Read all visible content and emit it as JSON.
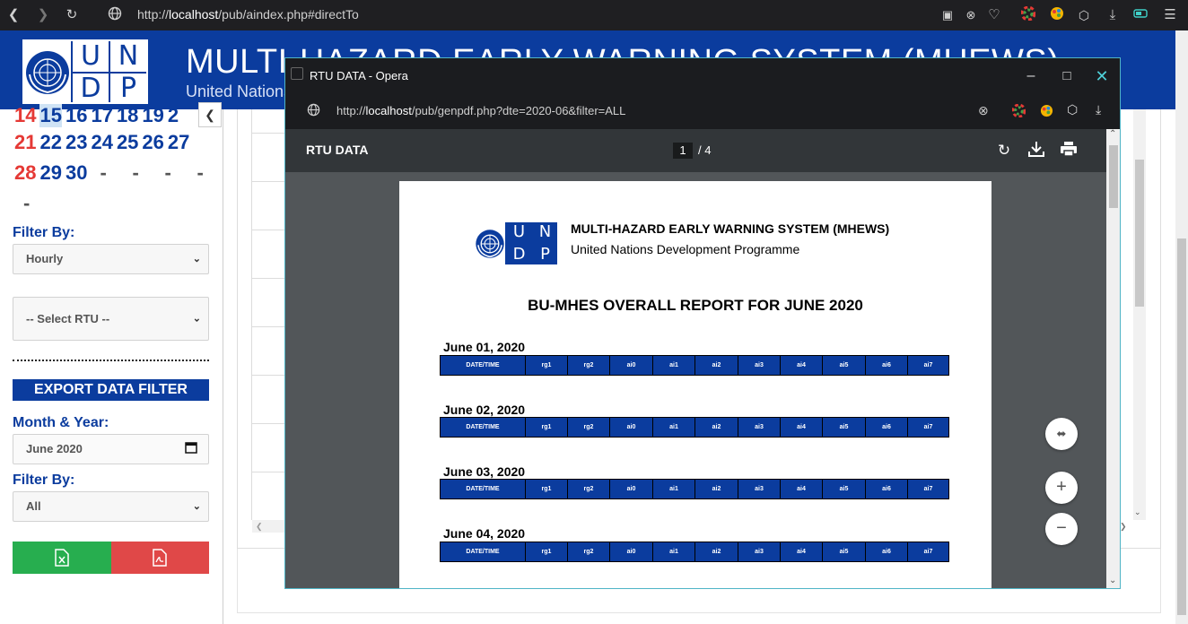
{
  "browser": {
    "url_prefix": "http://",
    "url_host": "localhost",
    "url_path": "/pub/aindex.php#directTo"
  },
  "header": {
    "logo_letters": [
      "U",
      "N",
      "D",
      "P"
    ],
    "title": "MULTI-HAZARD EARLY WARNING SYSTEM (MHEWS)",
    "subtitle": "United Nations Development Programme"
  },
  "calendar": {
    "rows": [
      [
        "14",
        "15",
        "16",
        "17",
        "18",
        "19",
        "2"
      ],
      [
        "21",
        "22",
        "23",
        "24",
        "25",
        "26",
        "27"
      ],
      [
        "28",
        "29",
        "30",
        "-",
        "-",
        "-",
        "-"
      ],
      [
        "-"
      ]
    ]
  },
  "sidebar": {
    "filter_label_1": "Filter By:",
    "filter_select_1": "Hourly",
    "rtu_select": "-- Select RTU --",
    "export_title": "EXPORT DATA FILTER",
    "month_year_label": "Month & Year:",
    "month_year_value": "June 2020",
    "filter_label_2": "Filter By:",
    "filter_select_2": "All"
  },
  "popup": {
    "window_title": "RTU DATA - Opera",
    "url_prefix": "http://",
    "url_host": "localhost",
    "url_path": "/pub/genpdf.php?dte=2020-06&filter=ALL",
    "pdf_title": "RTU DATA",
    "page_current": "1",
    "page_total": "/  4"
  },
  "document": {
    "logo_letters": [
      "U",
      "N",
      "D",
      "P"
    ],
    "org_title": "MULTI-HAZARD EARLY WARNING SYSTEM (MHEWS)",
    "org_subtitle": "United Nations Development Programme",
    "report_title": "BU-MHES OVERALL REPORT FOR JUNE 2020",
    "columns": [
      "DATE/TIME",
      "rg1",
      "rg2",
      "ai0",
      "ai1",
      "ai2",
      "ai3",
      "ai4",
      "ai5",
      "ai6",
      "ai7"
    ],
    "days": [
      "June 01, 2020",
      "June 02, 2020",
      "June 03, 2020",
      "June 04, 2020"
    ]
  },
  "colors": {
    "brand_blue": "#0b3c9e",
    "excel_green": "#27ae4f",
    "pdf_red": "#e04848",
    "popup_border": "#4fb4c6"
  }
}
